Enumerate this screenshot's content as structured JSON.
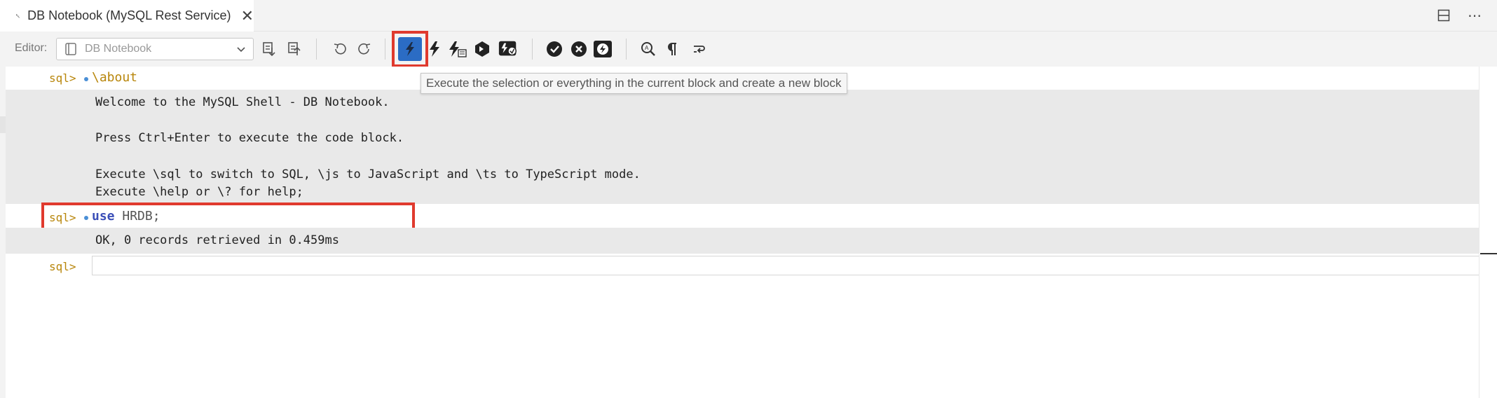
{
  "tab": {
    "title": "DB Notebook (MySQL Rest Service)",
    "close": "✕"
  },
  "tab_actions": [
    {
      "name": "split-editor-icon"
    },
    {
      "name": "more-actions-icon",
      "glyph": "⋯"
    }
  ],
  "toolbar": {
    "editor_label": "Editor:",
    "editor_value": "DB Notebook"
  },
  "tooltip": {
    "text": "Execute the selection or everything in the current block and create a new block"
  },
  "notebook": {
    "prompt": "sql>",
    "cells": [
      {
        "code": "\\about"
      },
      {
        "keyword": "use",
        "rest": " HRDB;"
      }
    ],
    "output1": [
      "Welcome to the MySQL Shell - DB Notebook.",
      "Press Ctrl+Enter to execute the code block.",
      "Execute \\sql to switch to SQL, \\js to JavaScript and \\ts to TypeScript mode.",
      "Execute \\help or \\? for help;"
    ],
    "output2": "OK, 0 records retrieved in 0.459ms"
  },
  "colors": {
    "prompt": "#b8860b",
    "keyword": "#3b4fb8",
    "highlight": "#e03a2e",
    "active_button": "#2b6cc4"
  }
}
